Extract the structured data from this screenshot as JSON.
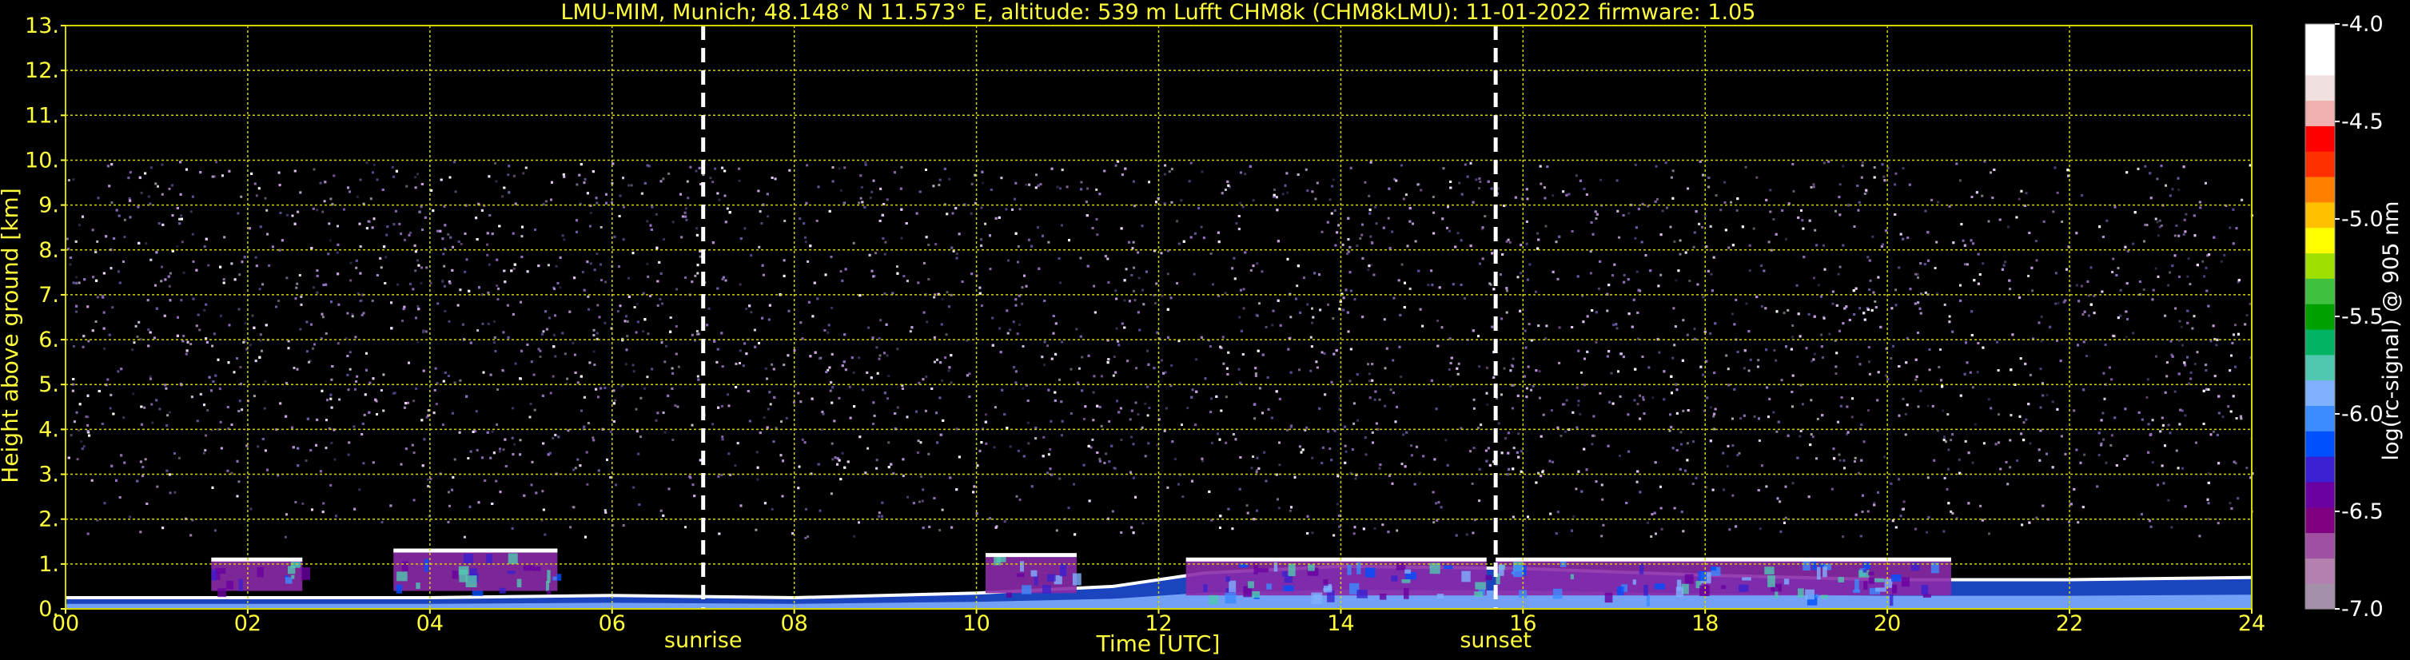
{
  "chart_data": {
    "type": "heatmap",
    "title": "LMU-MIM, Munich; 48.148° N 11.573° E, altitude: 539 m    Lufft CHM8k (CHM8kLMU): 11-01-2022    firmware: 1.05",
    "xlabel": "Time [UTC]",
    "ylabel": "Height above ground [km]",
    "xlim": [
      0,
      24
    ],
    "ylim": [
      0,
      13
    ],
    "x_ticks": [
      0,
      2,
      4,
      6,
      8,
      10,
      12,
      14,
      16,
      18,
      20,
      22,
      24
    ],
    "x_tick_labels": [
      "00",
      "02",
      "04",
      "06",
      "08",
      "10",
      "12",
      "14",
      "16",
      "18",
      "20",
      "22",
      "24"
    ],
    "y_ticks": [
      0,
      1,
      2,
      3,
      4,
      5,
      6,
      7,
      8,
      9,
      10,
      11,
      12,
      13
    ],
    "y_tick_labels": [
      "0.",
      "1.",
      "2.",
      "3.",
      "4.",
      "5.",
      "6.",
      "7.",
      "8.",
      "9.",
      "10.",
      "11.",
      "12.",
      "13."
    ],
    "grid": true,
    "grid_color": "#d4d400",
    "signal_top_km": 10,
    "events": [
      {
        "label": "sunrise",
        "time": 7.0
      },
      {
        "label": "sunset",
        "time": 15.7
      }
    ],
    "colorbar": {
      "label": "log(rc-signal) @ 905 nm",
      "range": [
        -7.0,
        -4.0
      ],
      "ticks": [
        -4.0,
        -4.5,
        -5.0,
        -5.5,
        -6.0,
        -6.5,
        -7.0
      ],
      "tick_labels": [
        "-4.0",
        "-4.5",
        "-5.0",
        "-5.5",
        "-6.0",
        "-6.5",
        "-7.0"
      ],
      "colors": [
        "#a490a8",
        "#b480b0",
        "#a050a0",
        "#800080",
        "#6a00a0",
        "#3a20d0",
        "#0050ff",
        "#3c8cff",
        "#80b0ff",
        "#50c8b0",
        "#00b464",
        "#00a000",
        "#40c040",
        "#a0e000",
        "#ffff00",
        "#ffc000",
        "#ff8000",
        "#ff3000",
        "#ff0000",
        "#f0b0b0",
        "#f0e0e0",
        "#ffffff",
        "#ffffff"
      ]
    },
    "aerosol_layer_km": [
      {
        "t": 0,
        "h": 0.25
      },
      {
        "t": 2,
        "h": 0.25
      },
      {
        "t": 4,
        "h": 0.25
      },
      {
        "t": 6,
        "h": 0.3
      },
      {
        "t": 8,
        "h": 0.25
      },
      {
        "t": 10,
        "h": 0.35
      },
      {
        "t": 11.5,
        "h": 0.5
      },
      {
        "t": 12.5,
        "h": 0.8
      },
      {
        "t": 14,
        "h": 0.95
      },
      {
        "t": 16,
        "h": 0.9
      },
      {
        "t": 18,
        "h": 0.75
      },
      {
        "t": 20,
        "h": 0.65
      },
      {
        "t": 22,
        "h": 0.65
      },
      {
        "t": 24,
        "h": 0.7
      }
    ],
    "cloud_segments": [
      {
        "t0": 1.6,
        "t1": 2.6,
        "base_km": 0.4,
        "top_km": 1.1
      },
      {
        "t0": 3.6,
        "t1": 5.4,
        "base_km": 0.4,
        "top_km": 1.3
      },
      {
        "t0": 10.1,
        "t1": 11.1,
        "base_km": 0.35,
        "top_km": 1.2
      },
      {
        "t0": 12.3,
        "t1": 15.6,
        "base_km": 0.3,
        "top_km": 1.1
      },
      {
        "t0": 15.7,
        "t1": 20.7,
        "base_km": 0.3,
        "top_km": 1.1
      }
    ]
  }
}
